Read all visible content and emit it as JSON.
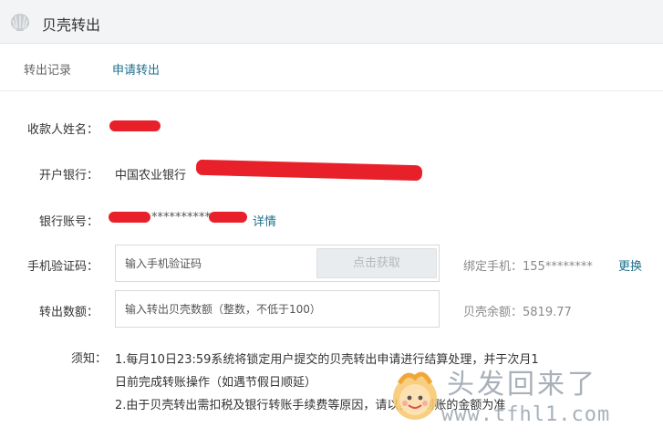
{
  "header": {
    "title": "贝壳转出",
    "icon": "shell-icon"
  },
  "tabs": [
    {
      "label": "转出记录",
      "active": false
    },
    {
      "label": "申请转出",
      "active": true
    }
  ],
  "form": {
    "payee_label": "收款人姓名：",
    "bank_label": "开户银行：",
    "bank_value": "中国农业银行",
    "account_label": "银行账号：",
    "account_masked": "**********",
    "details_link": "详情",
    "sms_label": "手机验证码：",
    "sms_placeholder": "输入手机验证码",
    "get_code_button": "点击获取",
    "bound_phone": "绑定手机：155********",
    "change_link": "更换",
    "amount_label": "转出数额：",
    "amount_placeholder": "输入转出贝壳数额（整数，不低于100）",
    "balance": "贝壳余额：5819.77"
  },
  "notice": {
    "label": "须知：",
    "line1": "1.每月10日23:59系统将锁定用户提交的贝壳转出申请进行结算处理，并于次月1",
    "line2": "日前完成转账操作（如遇节假日顺延）",
    "line3": "2.由于贝壳转出需扣税及银行转账手续费等原因，请以实际到账的金额为准"
  },
  "watermark": {
    "text": "头发回来了",
    "url": "www.tfhl1.com"
  },
  "colors": {
    "accent": "#1f6f8b",
    "redaction": "#e8202a",
    "header_bg": "#f3f4f6"
  }
}
